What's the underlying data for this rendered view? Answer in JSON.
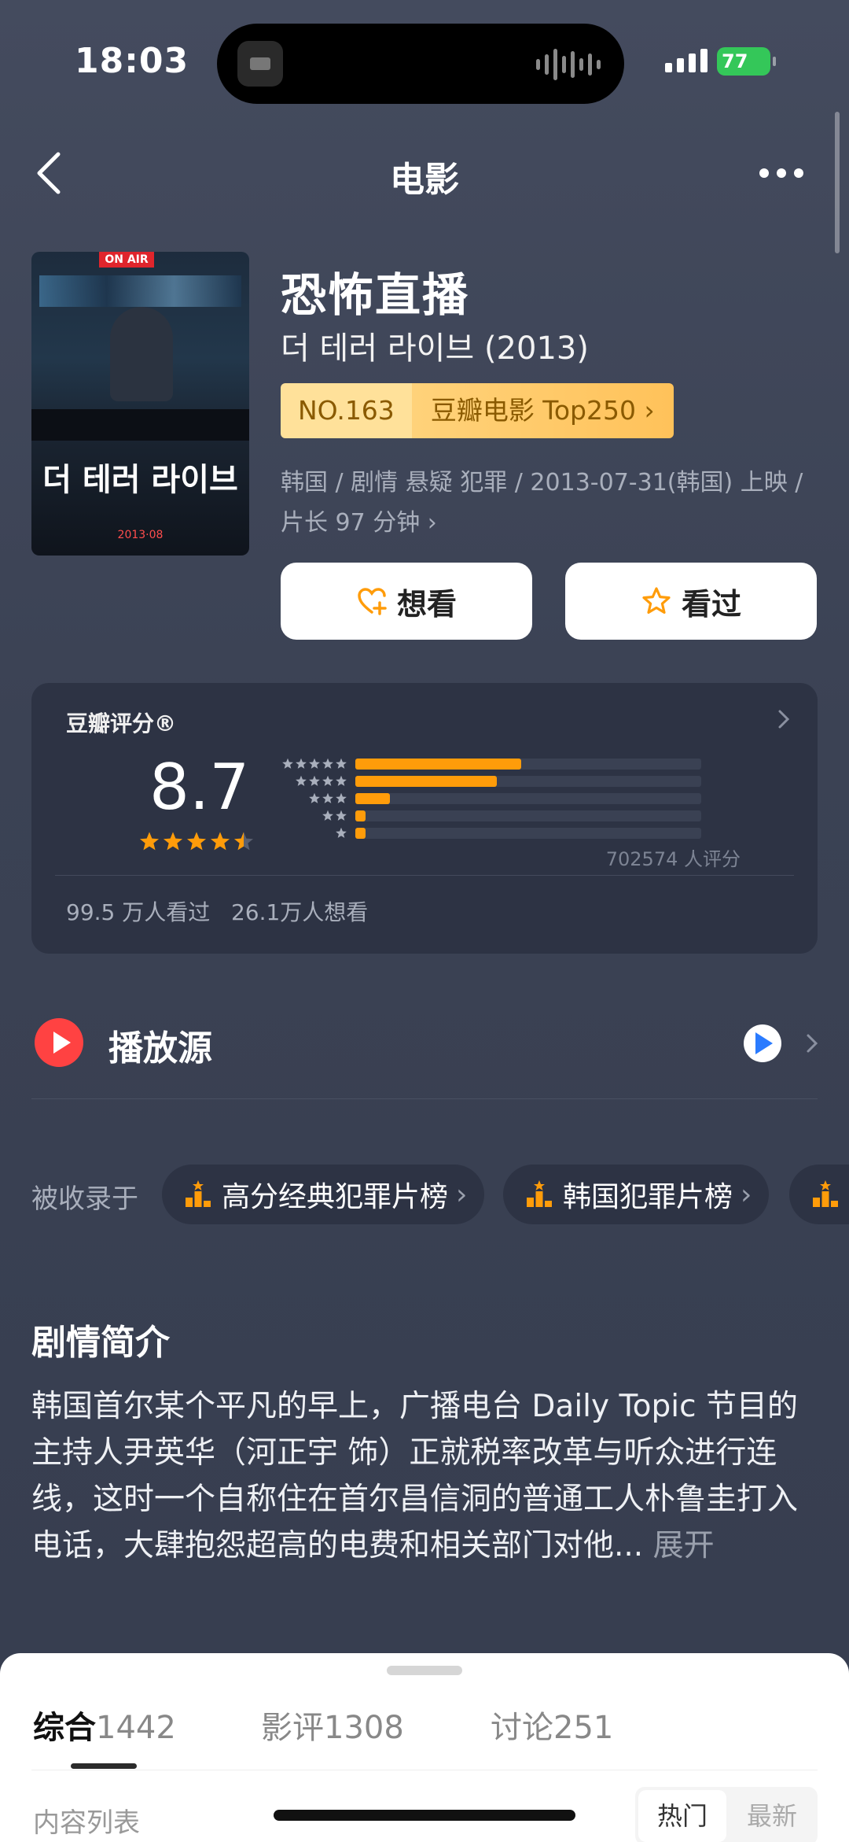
{
  "status_bar": {
    "time": "18:03",
    "battery": "77"
  },
  "nav": {
    "title": "电影"
  },
  "poster": {
    "on_air": "ON AIR",
    "title_ko": "더 테러 라이브",
    "date": "2013·08"
  },
  "movie": {
    "title": "恐怖直播",
    "original_title": "더 테러 라이브 (2013)",
    "rank_no": "NO.163",
    "rank_list": "豆瓣电影 Top250",
    "meta": "韩国 / 剧情 悬疑 犯罪 / 2013-07-31(韩国) 上映 / 片长 97 分钟"
  },
  "actions": {
    "want_label": "想看",
    "seen_label": "看过"
  },
  "rating": {
    "label": "豆瓣评分®",
    "score": "8.7",
    "stars": 4.5,
    "distribution": [
      {
        "stars": 5,
        "fraction": 0.48
      },
      {
        "stars": 4,
        "fraction": 0.41
      },
      {
        "stars": 3,
        "fraction": 0.1
      },
      {
        "stars": 2,
        "fraction": 0.03
      },
      {
        "stars": 1,
        "fraction": 0.03
      }
    ],
    "count": "702574 人评分",
    "watched": "99.5 万人看过",
    "wanted": "26.1万人想看"
  },
  "play_source": {
    "label": "播放源"
  },
  "collections": {
    "label": "被收录于",
    "items": [
      "高分经典犯罪片榜",
      "韩国犯罪片榜"
    ]
  },
  "synopsis": {
    "title": "剧情简介",
    "body": "韩国首尔某个平凡的早上，广播电台 Daily Topic 节目的主持人尹英华（河正宇 饰）正就税率改革与听众进行连线，这时一个自称住在首尔昌信洞的普通工人朴鲁圭打入电话，大肆抱怨超高的电费和相关部门对他...",
    "more": "展开"
  },
  "sheet": {
    "tabs": [
      {
        "name": "综合",
        "count": "1442"
      },
      {
        "name": "影评",
        "count": "1308"
      },
      {
        "name": "讨论",
        "count": "251"
      }
    ],
    "list_label": "内容列表",
    "sort_hot": "热门",
    "sort_new": "最新"
  },
  "colors": {
    "accent_orange": "#ff9c0a",
    "background": "#3b4254",
    "badge_gold": "#ffc25a"
  },
  "icons": {
    "back": "chevron-left-icon",
    "more": "more-dots-icon",
    "want": "heart-plus-icon",
    "seen": "star-outline-icon",
    "play": "play-circle-icon",
    "chart": "ranking-icon"
  }
}
